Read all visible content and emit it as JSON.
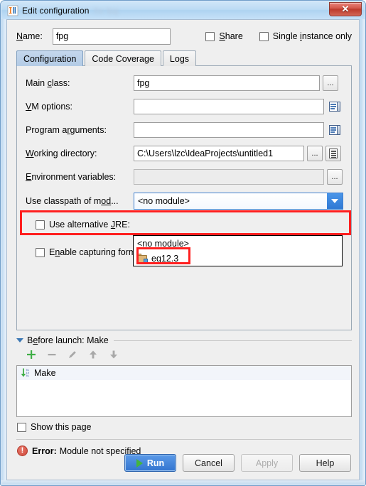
{
  "window": {
    "title": "Edit configuration",
    "title_blurred_suffix": "for fpg",
    "close_label": "✕",
    "app_icon": "intellij-idea-icon"
  },
  "name_row": {
    "label": "Name:",
    "value": "fpg",
    "placeholder": "",
    "share": {
      "label": "Share",
      "checked": false
    },
    "single_instance": {
      "label": "Single instance only",
      "checked": false
    }
  },
  "tabs": [
    {
      "label": "Configuration",
      "active": true
    },
    {
      "label": "Code Coverage",
      "active": false
    },
    {
      "label": "Logs",
      "active": false
    }
  ],
  "form": {
    "main_class": {
      "label": "Main class:",
      "value": "fpg",
      "button": "..."
    },
    "vm_options": {
      "label": "VM options:",
      "value": "",
      "icon": "expand-editor-icon"
    },
    "program_arguments": {
      "label": "Program arguments:",
      "value": "",
      "icon": "expand-editor-icon"
    },
    "working_directory": {
      "label": "Working directory:",
      "value": "C:\\Users\\lzc\\IdeaProjects\\untitled1",
      "button": "...",
      "icon": "macro-list-icon"
    },
    "environment_variables": {
      "label": "Environment variables:",
      "value": "",
      "button": "...",
      "disabled": true
    },
    "use_classpath_of_module": {
      "label": "Use classpath of mod...",
      "selected": "<no module>",
      "options": [
        {
          "label": "<no module>",
          "icon": null
        },
        {
          "label": "eg12.3",
          "icon": "module-folder-icon"
        }
      ],
      "expanded": true
    },
    "use_alternative_jre": {
      "label": "Use alternative JRE:",
      "checked": false
    },
    "enable_capturing_form_snapshots": {
      "label": "Enable capturing form snapshots",
      "checked": false
    }
  },
  "before_launch": {
    "title": "Before launch: Make",
    "toolbar": [
      {
        "name": "add-button",
        "glyph": "+"
      },
      {
        "name": "remove-button",
        "glyph": "−"
      },
      {
        "name": "edit-button",
        "glyph": "pencil"
      },
      {
        "name": "move-up-button",
        "glyph": "↑"
      },
      {
        "name": "move-down-button",
        "glyph": "↓"
      }
    ],
    "items": [
      {
        "label": "Make",
        "icon": "make-build-icon"
      }
    ],
    "show_this_page": {
      "label": "Show this page",
      "checked": false
    }
  },
  "error": {
    "icon": "error-icon",
    "label": "Error:",
    "message": "Module not specified"
  },
  "buttons": {
    "run": "Run",
    "cancel": "Cancel",
    "apply": "Apply",
    "help": "Help"
  },
  "colors": {
    "accent_blue": "#3274cf",
    "annotation_red": "#ff1f1f",
    "error_red": "#cf4a3b",
    "active_tab": "#b3cbe5",
    "run_play_green": "#43b43f"
  }
}
